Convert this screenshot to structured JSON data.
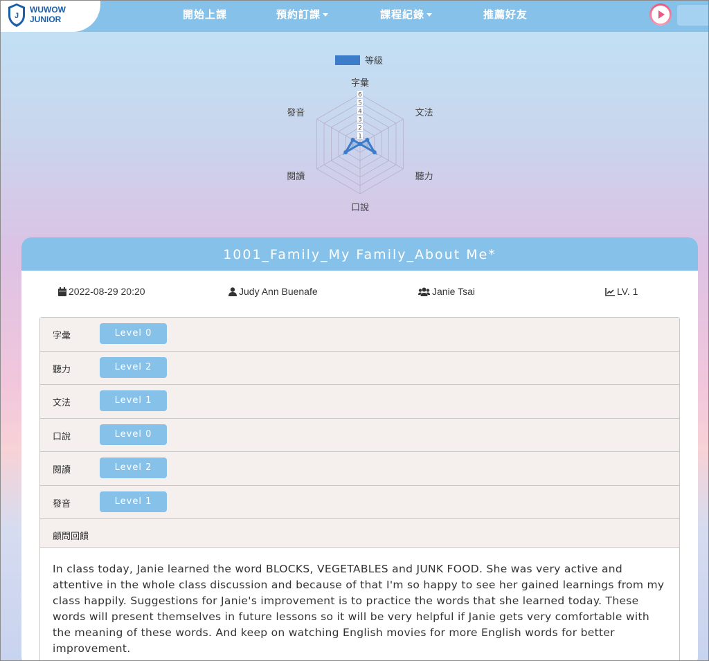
{
  "nav": {
    "logo_line1": "WUWOW",
    "logo_line2": "JUNIOR",
    "items": [
      {
        "label": "開始上課",
        "dropdown": false
      },
      {
        "label": "預約訂課",
        "dropdown": true
      },
      {
        "label": "課程紀錄",
        "dropdown": true
      },
      {
        "label": "推薦好友",
        "dropdown": false
      }
    ]
  },
  "chart_data": {
    "type": "radar",
    "legend": "等級",
    "axes": [
      "字彙",
      "文法",
      "聽力",
      "口說",
      "閱讀",
      "發音"
    ],
    "values": [
      0,
      1,
      2,
      0,
      2,
      1
    ],
    "rlim": [
      0,
      6
    ],
    "ticks": [
      "1",
      "2",
      "3",
      "4",
      "5",
      "6"
    ],
    "color": "#3d7cc9"
  },
  "session": {
    "title": "1001_Family_My Family_About Me*",
    "datetime": "2022-08-29 20:20",
    "consultant": "Judy Ann Buenafe",
    "student": "Janie Tsai",
    "level": "LV. 1"
  },
  "skills": [
    {
      "name": "字彙",
      "level": "Level 0"
    },
    {
      "name": "聽力",
      "level": "Level 2"
    },
    {
      "name": "文法",
      "level": "Level 1"
    },
    {
      "name": "口說",
      "level": "Level 0"
    },
    {
      "name": "閱讀",
      "level": "Level 2"
    },
    {
      "name": "發音",
      "level": "Level 1"
    }
  ],
  "feedback": {
    "label": "顧問回饋",
    "text": "In class today, Janie learned the word BLOCKS, VEGETABLES and JUNK FOOD. She was very active and attentive in the whole class discussion and because of that I'm so happy to see her gained learnings from my class happily. Suggestions for Janie's improvement is to practice the words that she learned today. These words will present themselves in future lessons so it will be very helpful if Janie gets very comfortable with the meaning of these words. And keep on watching English movies for more English words for better improvement."
  }
}
